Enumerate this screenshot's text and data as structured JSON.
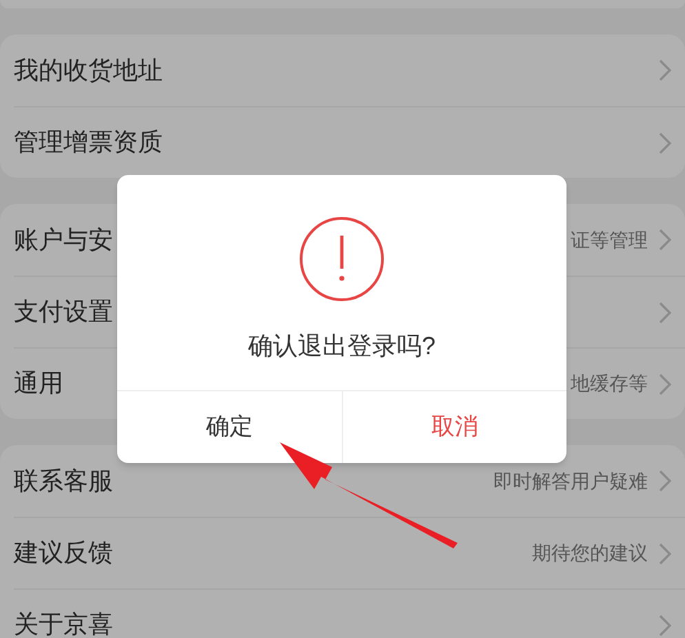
{
  "sections": [
    {
      "rows": [
        {
          "label": "我的收货地址"
        },
        {
          "label": "管理增票资质"
        }
      ]
    },
    {
      "rows": [
        {
          "label": "账户与安",
          "detail": "证等管理"
        },
        {
          "label": "支付设置"
        },
        {
          "label": "通用",
          "detail": "地缓存等"
        }
      ]
    },
    {
      "rows": [
        {
          "label": "联系客服",
          "detail": "即时解答用户疑难"
        },
        {
          "label": "建议反馈",
          "detail": "期待您的建议"
        },
        {
          "label": "关于京喜"
        }
      ]
    }
  ],
  "dialog": {
    "message": "确认退出登录吗?",
    "buttons": [
      {
        "label": "确定",
        "kind": "confirm"
      },
      {
        "label": "取消",
        "kind": "cancel"
      }
    ]
  }
}
